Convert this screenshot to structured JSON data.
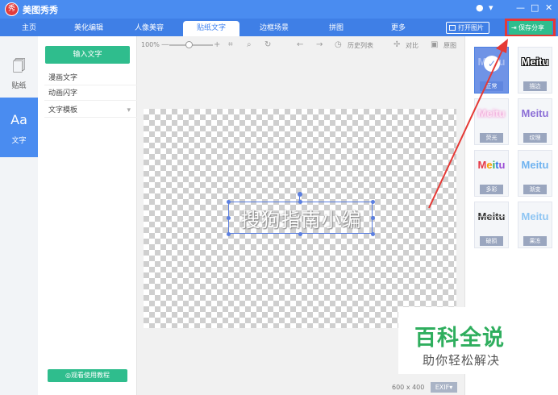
{
  "app": {
    "title": "美图秀秀",
    "logo_glyph": "秀"
  },
  "window_controls": {
    "minimize": "—",
    "maximize": "□",
    "close": "✕",
    "skin": "●",
    "menu": "▾"
  },
  "tabs": [
    {
      "label": "主页"
    },
    {
      "label": "美化编辑"
    },
    {
      "label": "人像美容"
    },
    {
      "label": "贴纸文字",
      "active": true
    },
    {
      "label": "边框场景"
    },
    {
      "label": "拼图"
    },
    {
      "label": "更多"
    }
  ],
  "header_actions": {
    "open_image": "打开图片",
    "save_share": "保存分享"
  },
  "left_nav": [
    {
      "icon": "sticker-icon",
      "glyph": "🗍",
      "label": "贴纸"
    },
    {
      "icon": "text-icon",
      "glyph": "Aa",
      "label": "文字",
      "active": true
    }
  ],
  "text_panel": {
    "input_button": "输入文字",
    "items": [
      "漫画文字",
      "动画闪字",
      "文字模板"
    ],
    "tutorial_button": "◎观看使用教程"
  },
  "toolbar": {
    "zoom": "100%",
    "history": "历史列表",
    "compare": "对比",
    "original": "原图"
  },
  "canvas": {
    "text": "搜狗指南小编",
    "size": "600 x 400",
    "exif": "EXIF▾"
  },
  "styles": [
    {
      "sample": "Meitu",
      "label": "正常",
      "selected": true
    },
    {
      "sample": "Meitu",
      "label": "描边"
    },
    {
      "sample": "Meitu",
      "label": "荧光"
    },
    {
      "sample": "Meitu",
      "label": "纹理"
    },
    {
      "sample": "Meitu",
      "label": "多彩"
    },
    {
      "sample": "Meitu",
      "label": "渐变"
    },
    {
      "sample": "Meitu",
      "label": "破损"
    },
    {
      "sample": "Meitu",
      "label": "果冻"
    }
  ],
  "watermark": {
    "title": "百科全说",
    "subtitle": "助你轻松解决"
  },
  "colors": {
    "header": "#4a8cf0",
    "accent_green": "#2fbd8d",
    "highlight_red": "#e53935"
  }
}
